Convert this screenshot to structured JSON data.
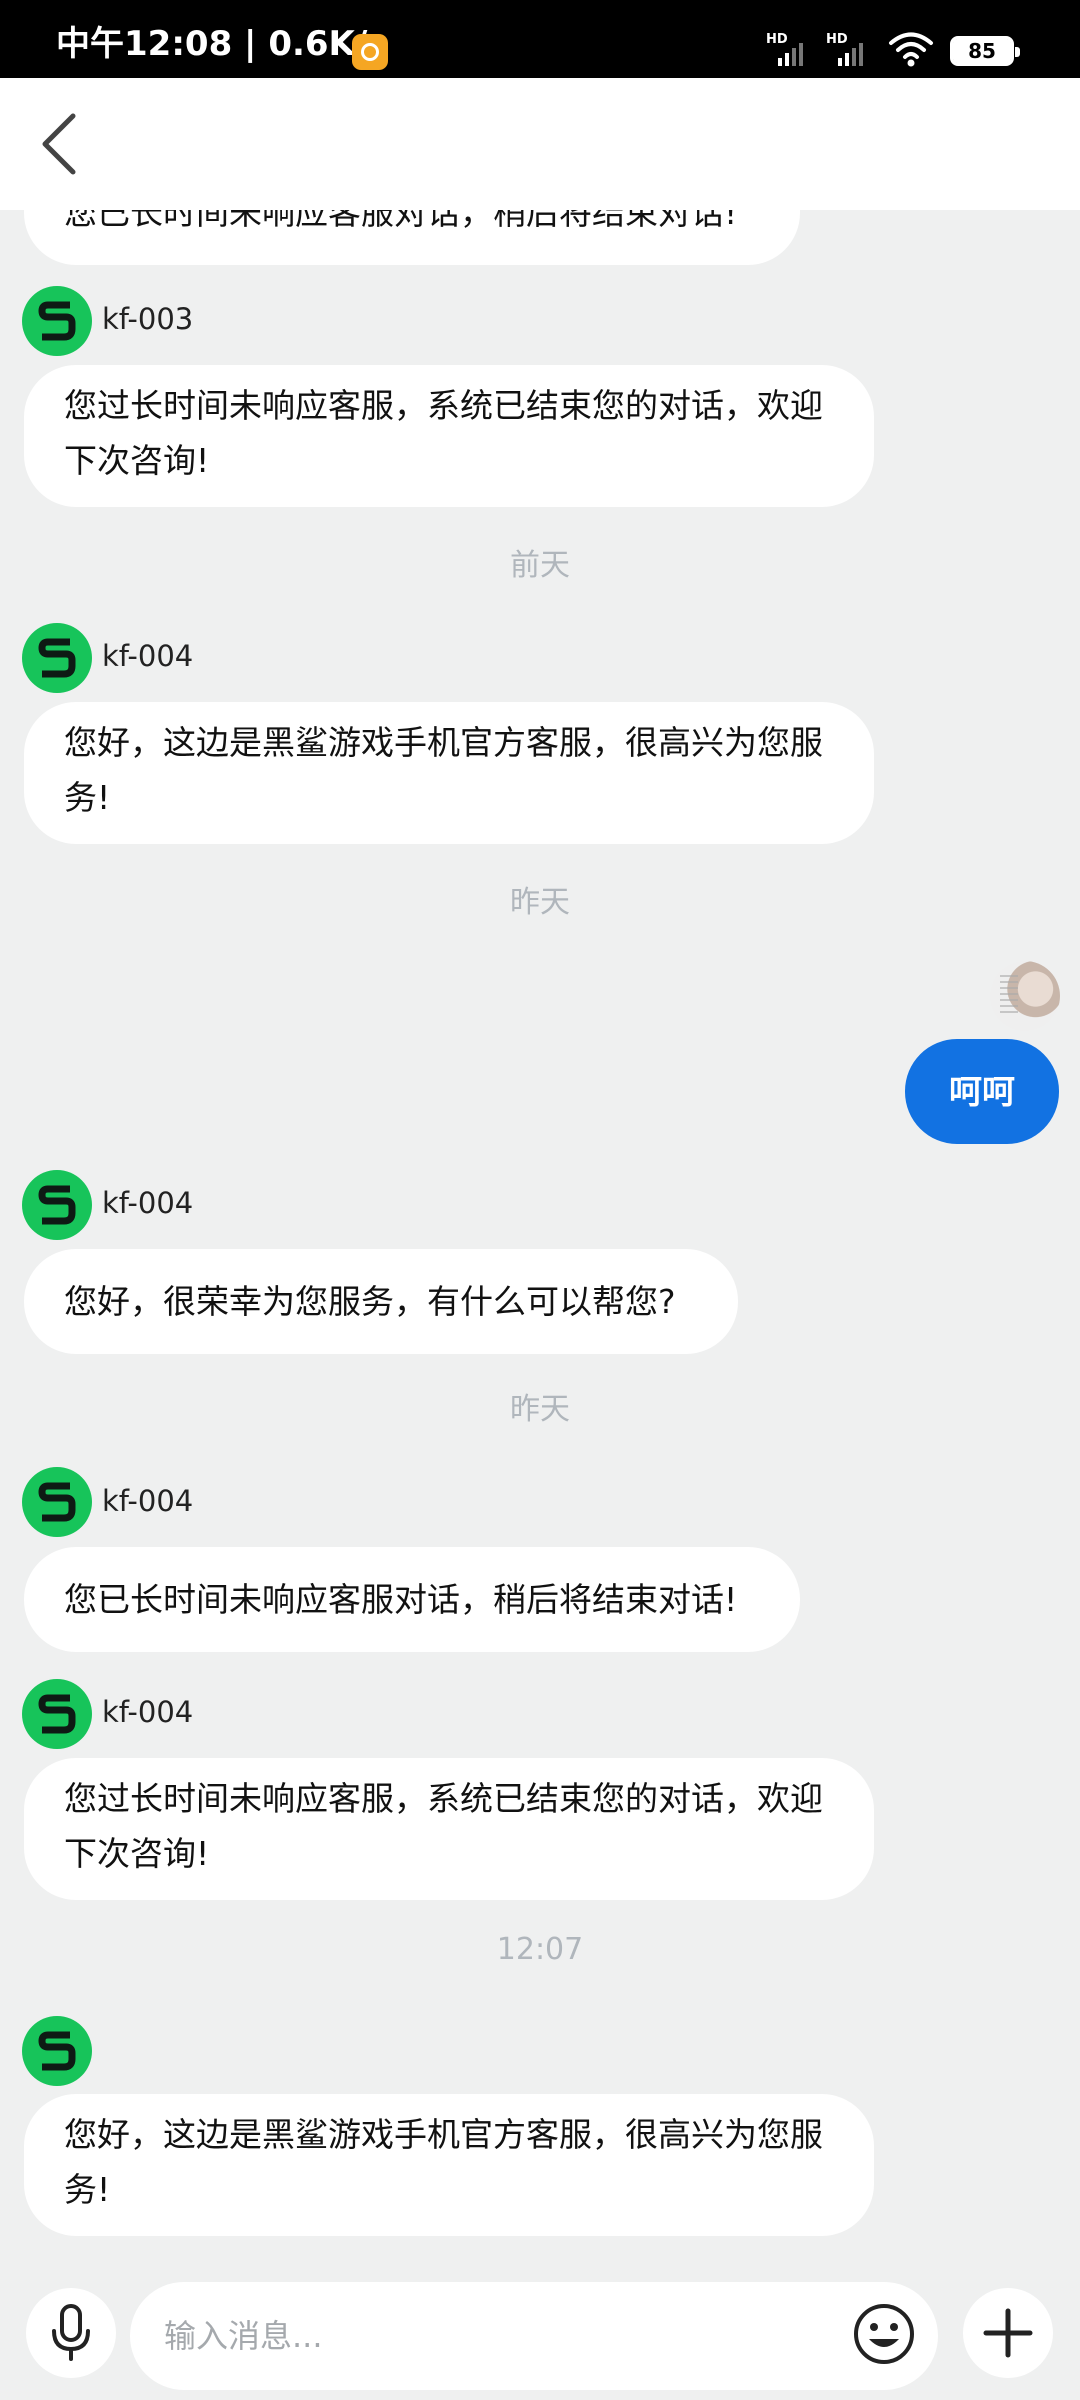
{
  "status_bar": {
    "time_speed": "中午12:08 | 0.6K/s",
    "signal_label": "HD",
    "battery": "85"
  },
  "messages": [
    {
      "type": "incoming",
      "text": "您已长时间未响应客服对话，稍后将结束对话!"
    },
    {
      "type": "incoming",
      "agent": "kf-003",
      "text": "您过长时间未响应客服，系统已结束您的对话，欢迎下次咨询!"
    },
    {
      "type": "date",
      "text": "前天"
    },
    {
      "type": "incoming",
      "agent": "kf-004",
      "text": "您好，这边是黑鲨游戏手机官方客服，很高兴为您服务!"
    },
    {
      "type": "date",
      "text": "昨天"
    },
    {
      "type": "outgoing",
      "text": "呵呵"
    },
    {
      "type": "incoming",
      "agent": "kf-004",
      "text": "您好，很荣幸为您服务，有什么可以帮您?"
    },
    {
      "type": "date",
      "text": "昨天"
    },
    {
      "type": "incoming",
      "agent": "kf-004",
      "text": "您已长时间未响应客服对话，稍后将结束对话!"
    },
    {
      "type": "incoming",
      "agent": "kf-004",
      "text": "您过长时间未响应客服，系统已结束您的对话，欢迎下次咨询!"
    },
    {
      "type": "date",
      "text": "12:07"
    },
    {
      "type": "incoming",
      "agent": "",
      "text": "您好，这边是黑鲨游戏手机官方客服，很高兴为您服务!"
    }
  ],
  "input": {
    "placeholder": "输入消息..."
  },
  "colors": {
    "agent_avatar": "#17c45a",
    "outgoing_bubble": "#1272e2",
    "background": "#eff0f0"
  },
  "icons": {
    "back": "chevron-left-icon",
    "agent_avatar": "black-shark-logo-icon",
    "mic": "microphone-icon",
    "emoji": "smiley-icon",
    "plus": "plus-icon"
  }
}
